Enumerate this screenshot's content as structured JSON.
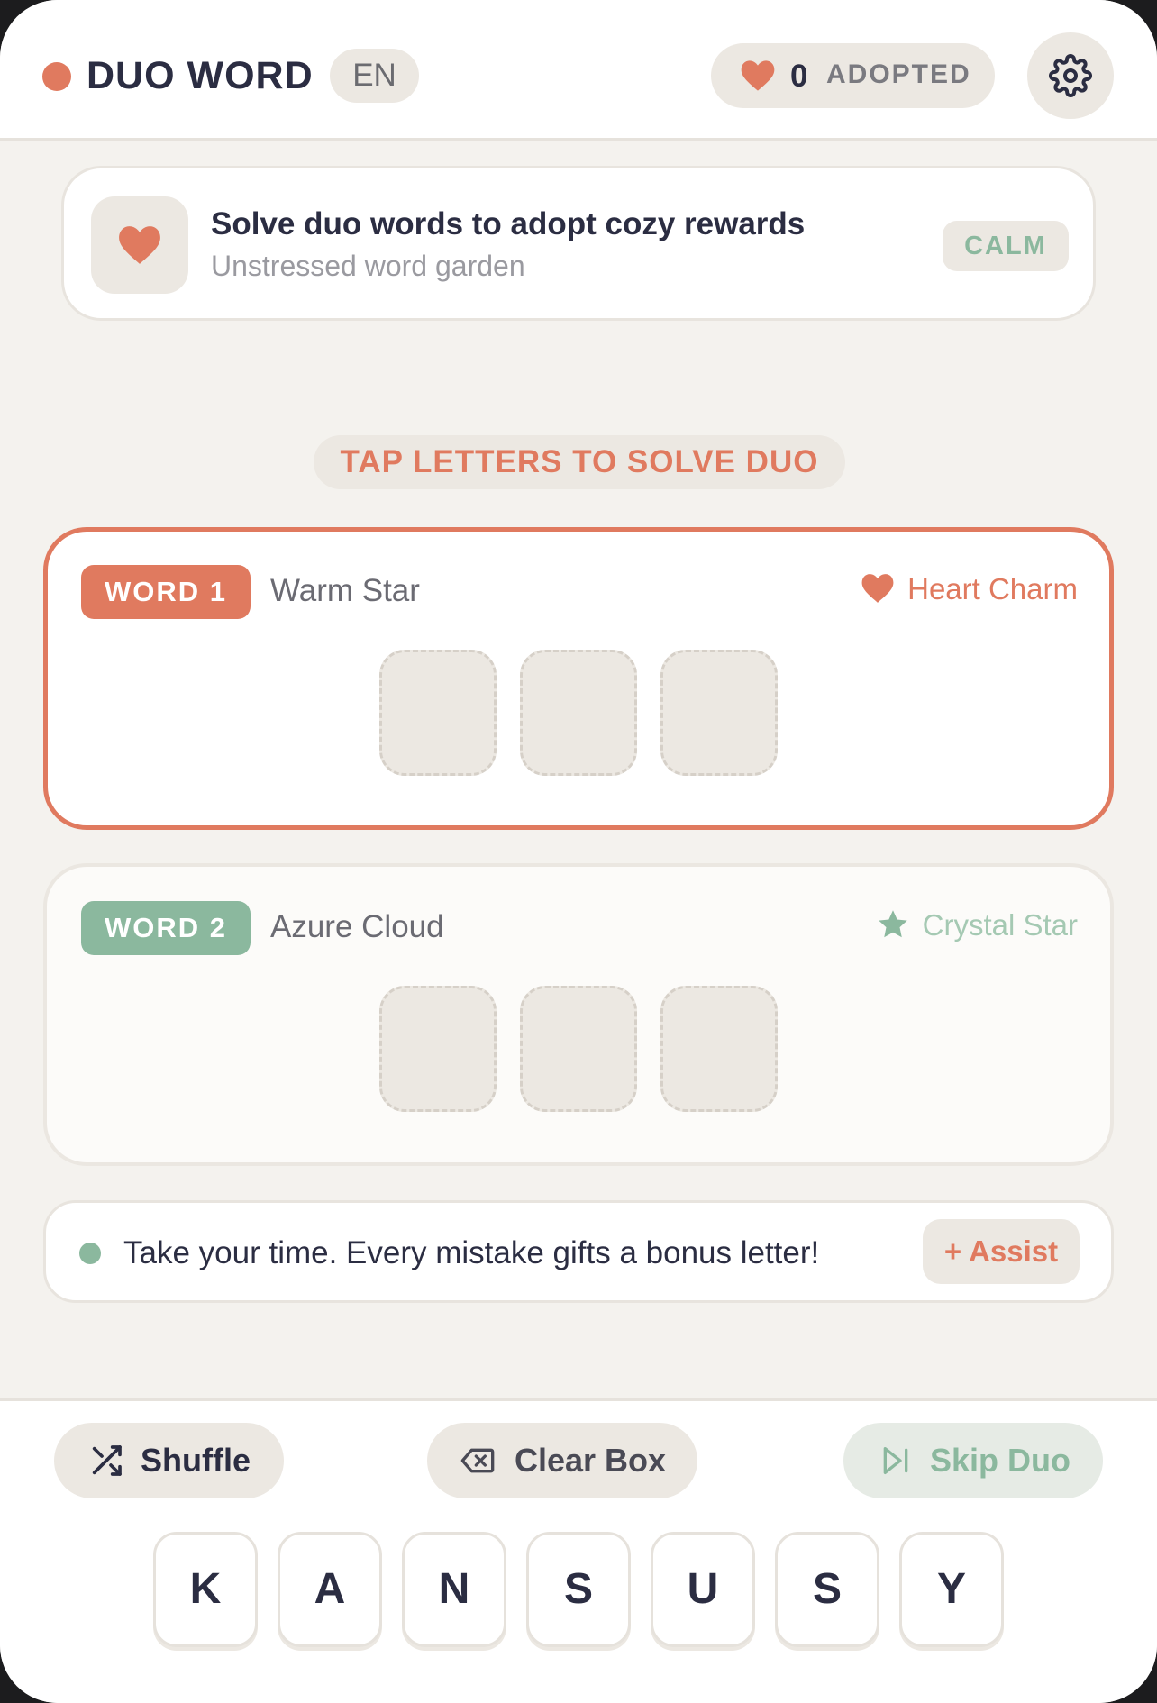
{
  "header": {
    "brand": "DUO WORD",
    "language": "EN",
    "adopted_count": "0",
    "adopted_label": "ADOPTED"
  },
  "banner": {
    "title": "Solve duo words to adopt cozy rewards",
    "subtitle": "Unstressed word garden",
    "mode": "CALM"
  },
  "instruction": "TAP LETTERS TO SOLVE DUO",
  "words": [
    {
      "badge": "WORD 1",
      "name": "Warm Star",
      "reward": "Heart Charm",
      "reward_icon": "heart-icon",
      "active": true,
      "letters": [
        "",
        "",
        ""
      ]
    },
    {
      "badge": "WORD 2",
      "name": "Azure Cloud",
      "reward": "Crystal Star",
      "reward_icon": "star-icon",
      "active": false,
      "letters": [
        "",
        "",
        ""
      ]
    }
  ],
  "hint": {
    "text": "Take your time. Every mistake gifts a bonus letter!",
    "assist_label": "+ Assist"
  },
  "actions": {
    "shuffle": "Shuffle",
    "clear": "Clear Box",
    "skip": "Skip Duo"
  },
  "keys": [
    "K",
    "A",
    "N",
    "S",
    "U",
    "S",
    "Y"
  ],
  "colors": {
    "accent": "#e07a5f",
    "secondary": "#8bb89e",
    "background": "#f4f2ee",
    "pill": "#ece8e2",
    "text": "#2b2d42"
  }
}
